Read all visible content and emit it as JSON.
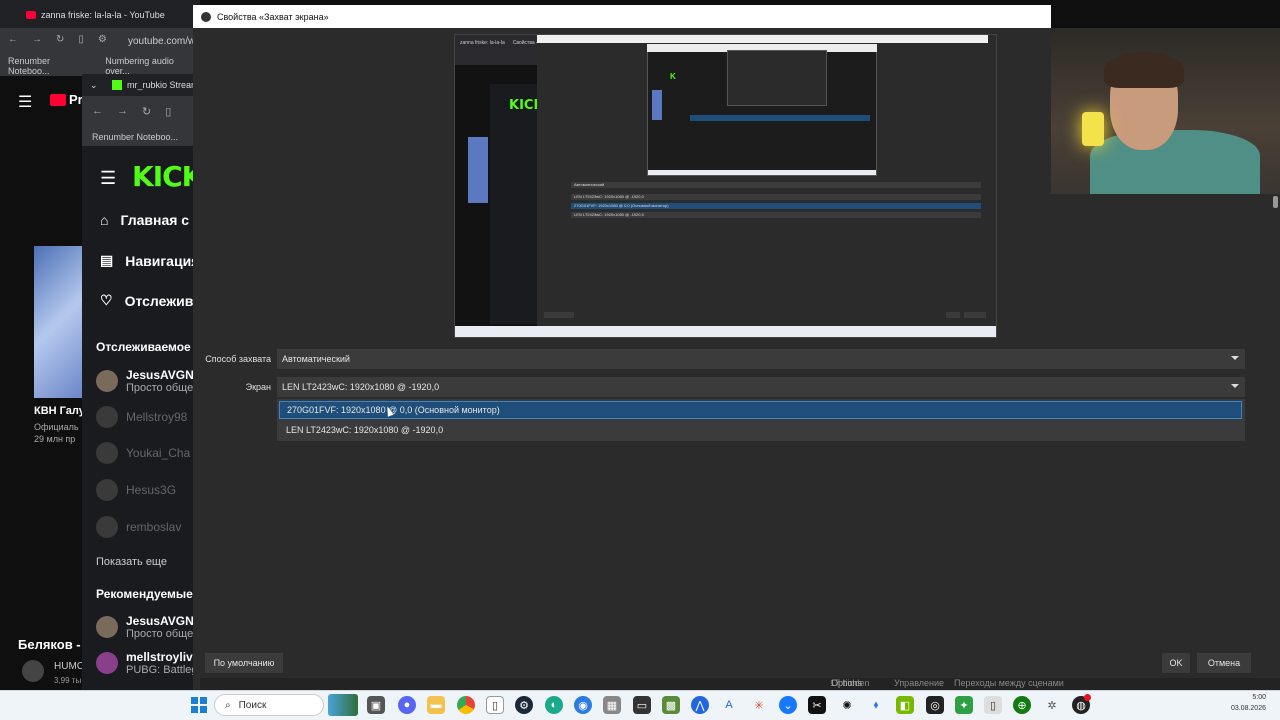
{
  "background_browser_youtube": {
    "tab_title": "zanna friske: la-la-la - YouTube",
    "url": "youtube.com/w",
    "bookmarks": [
      "Renumber Noteboo...",
      "Numbering audio over..."
    ],
    "logo_fragment": "Pr",
    "video_title": "КВН Галу",
    "video_channel": "Официаль",
    "video_views": "29 млн пр",
    "bottom_title": "Беляков -",
    "bottom_sub": "HUMC",
    "bottom_meta": "3,99 ты"
  },
  "background_browser_kick": {
    "tab_title": "mr_rubkio Stream",
    "bookmark": "Renumber Noteboo...",
    "logo": "KICK",
    "nav": [
      {
        "label": "Главная с",
        "icon": "home-icon"
      },
      {
        "label": "Навигация",
        "icon": "browse-icon"
      },
      {
        "label": "Отслежив",
        "icon": "heart-icon"
      }
    ],
    "following_heading": "Отслеживаемое",
    "following": [
      {
        "name": "JesusAVGN",
        "sub": "Просто обще",
        "live": true
      },
      {
        "name": "Mellstroy98",
        "sub": "",
        "live": false
      },
      {
        "name": "Youkai_Cha",
        "sub": "",
        "live": false
      },
      {
        "name": "Hesus3G",
        "sub": "",
        "live": false
      },
      {
        "name": "remboslav",
        "sub": "",
        "live": false
      }
    ],
    "show_more": "Показать еще",
    "recommended_heading": "Рекомендуемые",
    "recommended": [
      {
        "name": "JesusAVGN",
        "sub": "Просто обще"
      },
      {
        "name": "mellstroylive",
        "sub": "PUBG: Battleg"
      }
    ]
  },
  "dialog": {
    "title": "Свойства «Захват экрана»",
    "capture_method_label": "Способ захвата",
    "capture_method_value": "Автоматический",
    "screen_label": "Экран",
    "screen_value": "LEN LT2423wC: 1920x1080 @ -1920,0",
    "screen_options": [
      {
        "label": "270G01FVF: 1920x1080 @ 0,0 (Основной монитор)",
        "selected": true
      },
      {
        "label": "LEN LT2423wC: 1920x1080 @ -1920,0",
        "selected": false
      }
    ],
    "defaults_button": "По умолчанию",
    "ok_button": "OK",
    "cancel_button": "Отмена"
  },
  "preview": {
    "mini_tabs": [
      "zanna friske: la-la-la",
      "Свойства «Захват экрана»"
    ],
    "mini_kick_logo": "KICK",
    "mini_combo": "Автоматический",
    "mini_rows": [
      "LEN LT2423wC: 1920x1080 @ -1920,0",
      "270G01FVF: 1920x1080 @ 0,0 (Основной монитор)",
      "LEN LT2423wC: 1920x1080 @ -1920,0"
    ]
  },
  "obs_peek": {
    "options_label": "Options",
    "hidden_label": "17 hidden",
    "transitions_label": "Управление",
    "scene_transitions_label": "Переходы между сценами"
  },
  "taskbar": {
    "search_placeholder": "Поиск",
    "time": "5:00",
    "date": "03.08.2026",
    "icons": [
      "file-explorer-icon",
      "folder-icon",
      "chrome-icon",
      "notepad-icon",
      "steam-icon",
      "edge-icon",
      "chrome-beta-icon",
      "terminal-icon",
      "minecraft-icon",
      "arc-icon",
      "a-icon",
      "flower-icon",
      "vpn-icon",
      "capcut-icon",
      "openai-icon",
      "stick-icon",
      "nvidia-icon",
      "obs-camera-icon",
      "green-app-icon",
      "file-icon",
      "xbox-icon",
      "settings-icon",
      "obs-icon"
    ]
  },
  "colors": {
    "kick_green": "#53fc18",
    "dialog_bg": "#2b2b2b",
    "selection_blue": "#1e4e79",
    "youtube_red": "#ff0033"
  }
}
